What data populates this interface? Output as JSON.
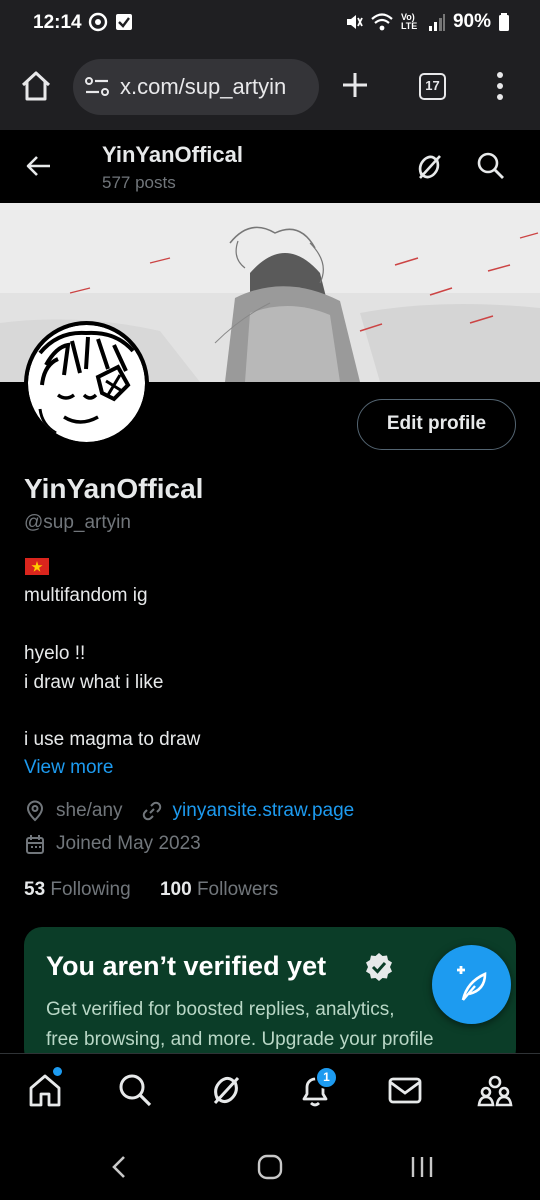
{
  "status_bar": {
    "time": "12:14",
    "battery": "90%",
    "network": "Vo) LTE"
  },
  "browser": {
    "url": "x.com/sup_artyin",
    "tab_count": "17"
  },
  "header": {
    "name": "YinYanOffical",
    "posts": "577 posts"
  },
  "profile": {
    "edit_label": "Edit profile",
    "name": "YinYanOffical",
    "handle": "@sup_artyin",
    "bio_lines": [
      "multifandom ig",
      "hyelo !!",
      "i draw what i like",
      "i use magma to draw"
    ],
    "view_more": "View more",
    "pronouns": "she/any",
    "website": "yinyansite.straw.page",
    "joined": "Joined May 2023",
    "following_count": "53",
    "following_label": "Following",
    "followers_count": "100",
    "followers_label": "Followers"
  },
  "verify": {
    "title": "You aren’t verified yet",
    "line1": "Get verified for boosted replies, analytics,",
    "line2": "free browsing, and more. Upgrade your profile"
  },
  "bottom_nav": {
    "notification_count": "1"
  },
  "colors": {
    "accent": "#1d9bf0",
    "muted": "#71767b",
    "card": "#0b3d28"
  }
}
